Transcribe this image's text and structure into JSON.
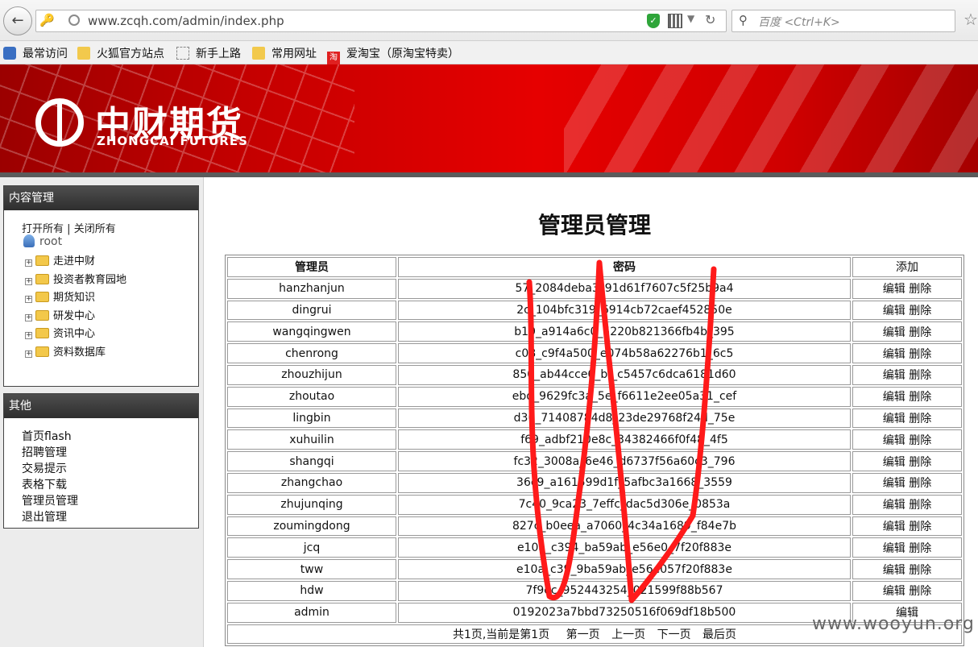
{
  "browser": {
    "url": "www.zcqh.com/admin/index.php",
    "search_placeholder": "百度 <Ctrl+K>",
    "bookmarks": [
      "最常访问",
      "火狐官方站点",
      "新手上路",
      "常用网址",
      "爱淘宝（原淘宝特卖）"
    ],
    "tao_glyph": "淘"
  },
  "banner": {
    "logo_cn": "中财期货",
    "logo_en": "ZHONGCAI FUTURES"
  },
  "sidebar": {
    "content_panel": {
      "title": "内容管理",
      "open_all": "打开所有",
      "separator": "|",
      "close_all": "关闭所有",
      "root": "root",
      "tree": [
        "走进中财",
        "投资者教育园地",
        "期货知识",
        "研发中心",
        "资讯中心",
        "资料数据库"
      ]
    },
    "other_panel": {
      "title": "其他",
      "items": [
        "首页flash",
        "招聘管理",
        "交易提示",
        "表格下载",
        "管理员管理",
        "退出管理"
      ]
    }
  },
  "main": {
    "title": "管理员管理",
    "columns": {
      "admin": "管理员",
      "password": "密码",
      "add": "添加"
    },
    "edit_label": "编辑",
    "delete_label": "删除",
    "rows": [
      {
        "name": "hanzhanjun",
        "pwd": "57_2084deba3_91d61f7607c5f25b9a4"
      },
      {
        "name": "dingrui",
        "pwd": "2c_104bfc319_6914cb72caef452850e"
      },
      {
        "name": "wangqingwen",
        "pwd": "b19_a914a6c0_5220b821366fb4b_395"
      },
      {
        "name": "chenrong",
        "pwd": "c08_c9f4a500_e074b58a62276b1_6c5"
      },
      {
        "name": "zhouzhijun",
        "pwd": "850_ab44cce6_bf_c5457c6dca6181d60"
      },
      {
        "name": "zhoutao",
        "pwd": "ebd_9629fc3a_5e_f6611e2ee05a31_cef"
      },
      {
        "name": "lingbin",
        "pwd": "d36_71408784d8_23de29768f24d_75e"
      },
      {
        "name": "xuhuilin",
        "pwd": "f69_adbf210e8c_34382466f0f48_4f5"
      },
      {
        "name": "shangqi",
        "pwd": "fc32_3008a_6e46_d6737f56a60c3_796"
      },
      {
        "name": "zhangchao",
        "pwd": "36c9_a161599d1f_5afbc3a1668_3559"
      },
      {
        "name": "zhujunqing",
        "pwd": "7c40_9ca23_7effc_dac5d306e_0853a"
      },
      {
        "name": "zoumingdong",
        "pwd": "827c_b0eea_a7060_4c34a1689_f84e7b"
      },
      {
        "name": "jcq",
        "pwd": "e10a_c394_ba59ab_e56e0_7f20f883e"
      },
      {
        "name": "tww",
        "pwd": "e10a_c39_9ba59ab_e56e057f20f883e"
      },
      {
        "name": "hdw",
        "pwd": "7f9ec_952443254_021599f88b567"
      },
      {
        "name": "admin",
        "pwd": "0192023a7bbd73250516f069df18b500"
      }
    ],
    "pager": {
      "info": "共1页,当前是第1页",
      "first": "第一页",
      "prev": "上一页",
      "next": "下一页",
      "last": "最后页"
    }
  },
  "watermark": "www.wooyun.org",
  "colors": {
    "banner_red": "#e60000",
    "scribble": "#ff1a1a",
    "panel_head": "#3a3a3a"
  }
}
